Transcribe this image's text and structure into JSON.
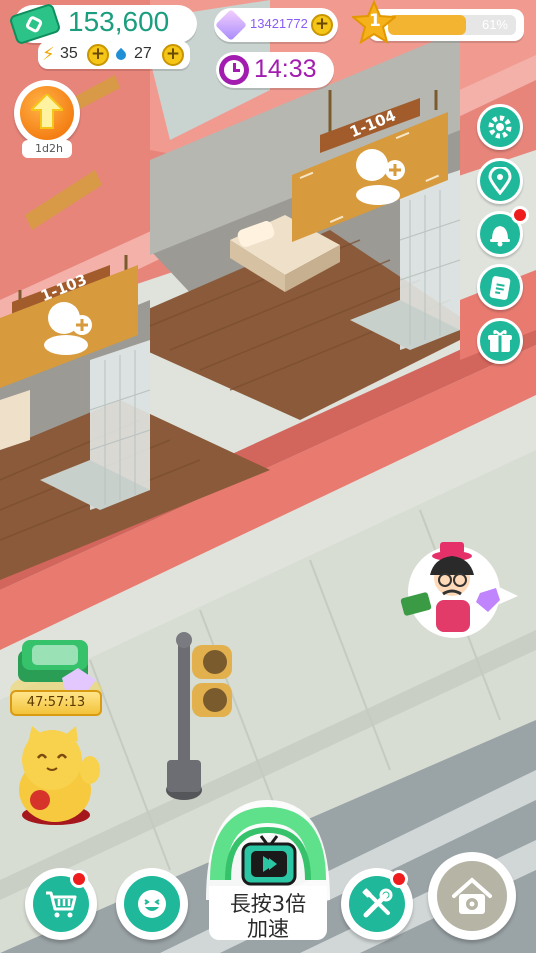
{
  "hud": {
    "cash": "153,600",
    "energy": "35",
    "water": "27",
    "gems": "13421772",
    "timer": "14:33",
    "level": "1",
    "level_progress_label": "61%",
    "level_progress": 0.61,
    "boost_timer": "1d2h"
  },
  "rooms": {
    "room_a": {
      "label": "1-104"
    },
    "room_b": {
      "label": "1-103"
    }
  },
  "reward": {
    "countdown": "47:57:13"
  },
  "speed_button": {
    "line1": "長按3倍",
    "line2": "加速"
  },
  "colors": {
    "accent_teal": "#1fb89a",
    "building_red": "#e87a70",
    "sign_wood": "#d79a3c",
    "gold": "#f5c518",
    "notification_red": "#ee1c1c",
    "timer_purple": "#a21caf"
  },
  "icons": {
    "cash": "cash-bill-icon",
    "energy": "lightning-icon",
    "water": "water-drop-icon",
    "gems": "gem-icon",
    "timer": "clock-icon",
    "level": "star-icon",
    "boost": "up-arrow-icon",
    "settings": "gear-icon",
    "location": "map-pin-icon",
    "notifications": "bell-icon",
    "tasks": "clipboard-icon",
    "gift": "gift-icon",
    "shop": "shopping-cart-icon",
    "social": "smiley-icon",
    "build": "tools-icon",
    "home": "home-gear-icon",
    "speed": "tv-play-icon"
  }
}
